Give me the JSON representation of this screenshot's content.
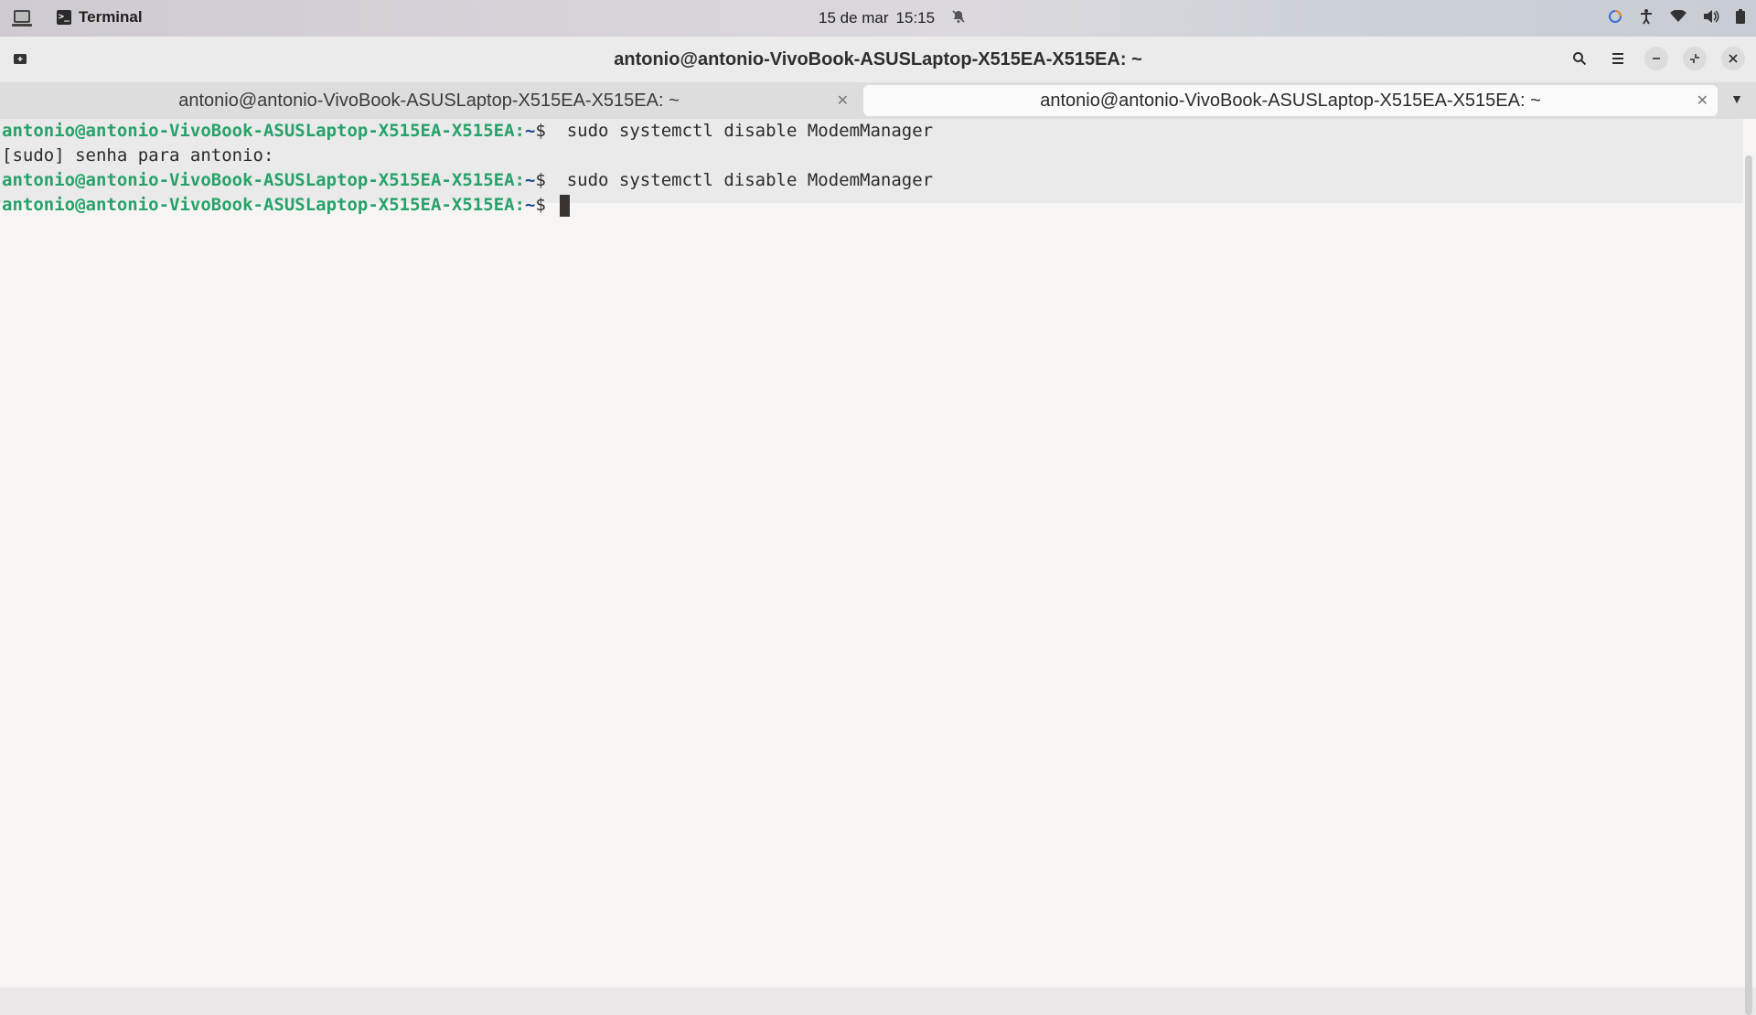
{
  "topbar": {
    "app_name": "Terminal",
    "date": "15 de mar",
    "time": "15:15",
    "icons": [
      "activities-icon",
      "terminal-app-icon",
      "notifications-off-icon",
      "night-light-icon",
      "accessibility-icon",
      "wifi-icon",
      "volume-icon",
      "battery-icon"
    ]
  },
  "window": {
    "title": "antonio@antonio-VivoBook-ASUSLaptop-X515EA-X515EA: ~",
    "tabs": [
      {
        "label": "antonio@antonio-VivoBook-ASUSLaptop-X515EA-X515EA: ~",
        "active": false
      },
      {
        "label": "antonio@antonio-VivoBook-ASUSLaptop-X515EA-X515EA: ~",
        "active": true
      }
    ]
  },
  "terminal": {
    "prompt_user": "antonio@antonio-VivoBook-ASUSLaptop-X515EA-X515EA",
    "prompt_dir": "~",
    "prompt_sym": "$",
    "lines": [
      {
        "type": "cmd",
        "text": "  sudo systemctl disable ModemManager"
      },
      {
        "type": "out",
        "text": "[sudo] senha para antonio:"
      },
      {
        "type": "cmd",
        "text": "  sudo systemctl disable ModemManager"
      },
      {
        "type": "cmd",
        "text": " "
      }
    ]
  },
  "colors": {
    "prompt_user": "#26a269",
    "prompt_dir": "#12488b",
    "cursor": "#3a3430"
  }
}
